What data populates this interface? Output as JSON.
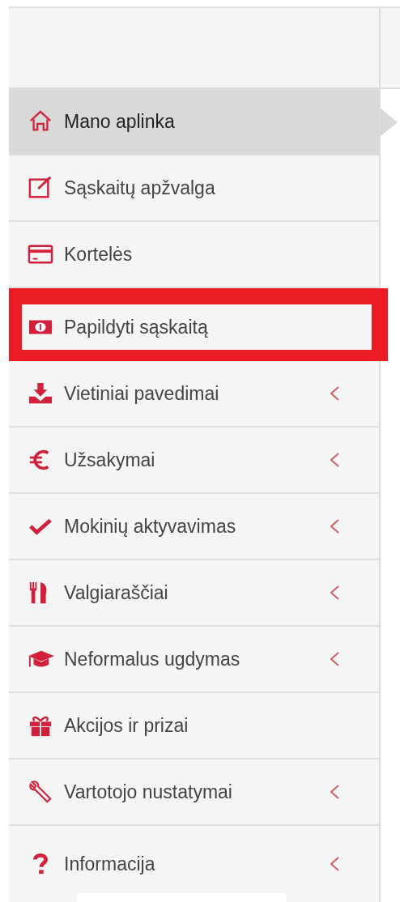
{
  "menu": [
    {
      "label": "Mano aplinka",
      "selected": true,
      "expandable": false,
      "highlighted": false
    },
    {
      "label": "Sąskaitų apžvalga",
      "selected": false,
      "expandable": false,
      "highlighted": false
    },
    {
      "label": "Kortelės",
      "selected": false,
      "expandable": false,
      "highlighted": false
    },
    {
      "label": "Papildyti sąskaitą",
      "selected": false,
      "expandable": false,
      "highlighted": true
    },
    {
      "label": "Vietiniai pavedimai",
      "selected": false,
      "expandable": true,
      "highlighted": false
    },
    {
      "label": "Užsakymai",
      "selected": false,
      "expandable": true,
      "highlighted": false
    },
    {
      "label": "Mokinių aktyvavimas",
      "selected": false,
      "expandable": true,
      "highlighted": false
    },
    {
      "label": "Valgiaraščiai",
      "selected": false,
      "expandable": true,
      "highlighted": false
    },
    {
      "label": "Neformalus ugdymas",
      "selected": false,
      "expandable": true,
      "highlighted": false
    },
    {
      "label": "Akcijos ir prizai",
      "selected": false,
      "expandable": false,
      "highlighted": false
    },
    {
      "label": "Vartotojo nustatymai",
      "selected": false,
      "expandable": true,
      "highlighted": false
    },
    {
      "label": "Informacija",
      "selected": false,
      "expandable": true,
      "highlighted": false
    }
  ]
}
